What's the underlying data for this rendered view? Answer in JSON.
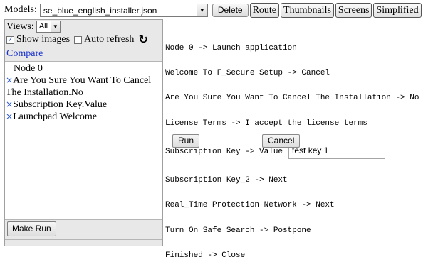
{
  "toolbar": {
    "models_label": "Models:",
    "model_selected": "se_blue_english_installer.json",
    "delete_label": "Delete",
    "route_label": "Route",
    "thumbnails_label": "Thumbnails",
    "screens_label": "Screens",
    "simplified_label": "Simplified"
  },
  "sidebar": {
    "views_label": "Views:",
    "views_selected": "All",
    "show_images_label": "Show images",
    "show_images_checked": true,
    "auto_refresh_label": "Auto refresh",
    "auto_refresh_checked": false,
    "refresh_icon": "refresh-icon",
    "compare_label": "Compare",
    "node_title": "Node 0",
    "items": [
      {
        "line1": "Are You Sure You Want To Cancel",
        "line2": "The Installation.No"
      },
      {
        "line1": "Subscription Key.Value",
        "line2": ""
      },
      {
        "line1": "Launchpad Welcome",
        "line2": ""
      }
    ],
    "make_run_label": "Make Run"
  },
  "route": {
    "steps": [
      "Node 0 -> Launch application",
      "Welcome To F_Secure Setup -> Cancel",
      "Are You Sure You Want To Cancel The Installation -> No",
      "License Terms -> I accept the license terms"
    ],
    "key_label": "Subscription Key -> Value",
    "key_value": "test key 1",
    "steps_after": [
      "Subscription Key_2 -> Next",
      "Real_Time Protection Network -> Next",
      "Turn On Safe Search -> Postpone",
      "Finished -> Close"
    ],
    "run_label": "Run",
    "cancel_label": "Cancel"
  },
  "colors": {
    "link": "#1a33cc",
    "remove_icon": "#2a5ad6",
    "panel_bg": "#e8e8e8"
  }
}
